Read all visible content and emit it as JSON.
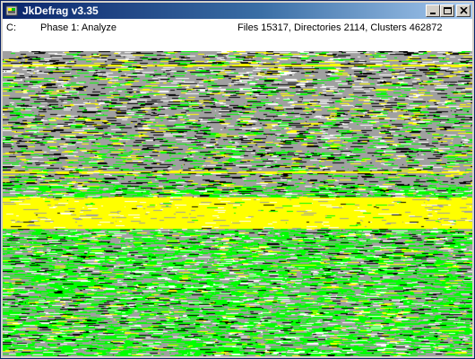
{
  "window": {
    "title": "JkDefrag v3.35",
    "title_color": "#ffffff",
    "titlebar_gradient": [
      "#0a246a",
      "#a6caf0"
    ],
    "app_icon": "jkdefrag-app-icon",
    "buttons": {
      "minimize_icon": "minimize-icon",
      "maximize_icon": "maximize-icon",
      "close_icon": "close-icon"
    }
  },
  "status": {
    "drive": "C:",
    "phase": "Phase 1: Analyze",
    "stats": "Files 15317, Directories 2114, Clusters 462872"
  },
  "disk_map": {
    "legend_colors": {
      "free": "#ffffff",
      "used": "#a0a0a0",
      "fragmented": "#ffff00",
      "unfragmented": "#00ff00",
      "unmovable": "#000000"
    }
  }
}
